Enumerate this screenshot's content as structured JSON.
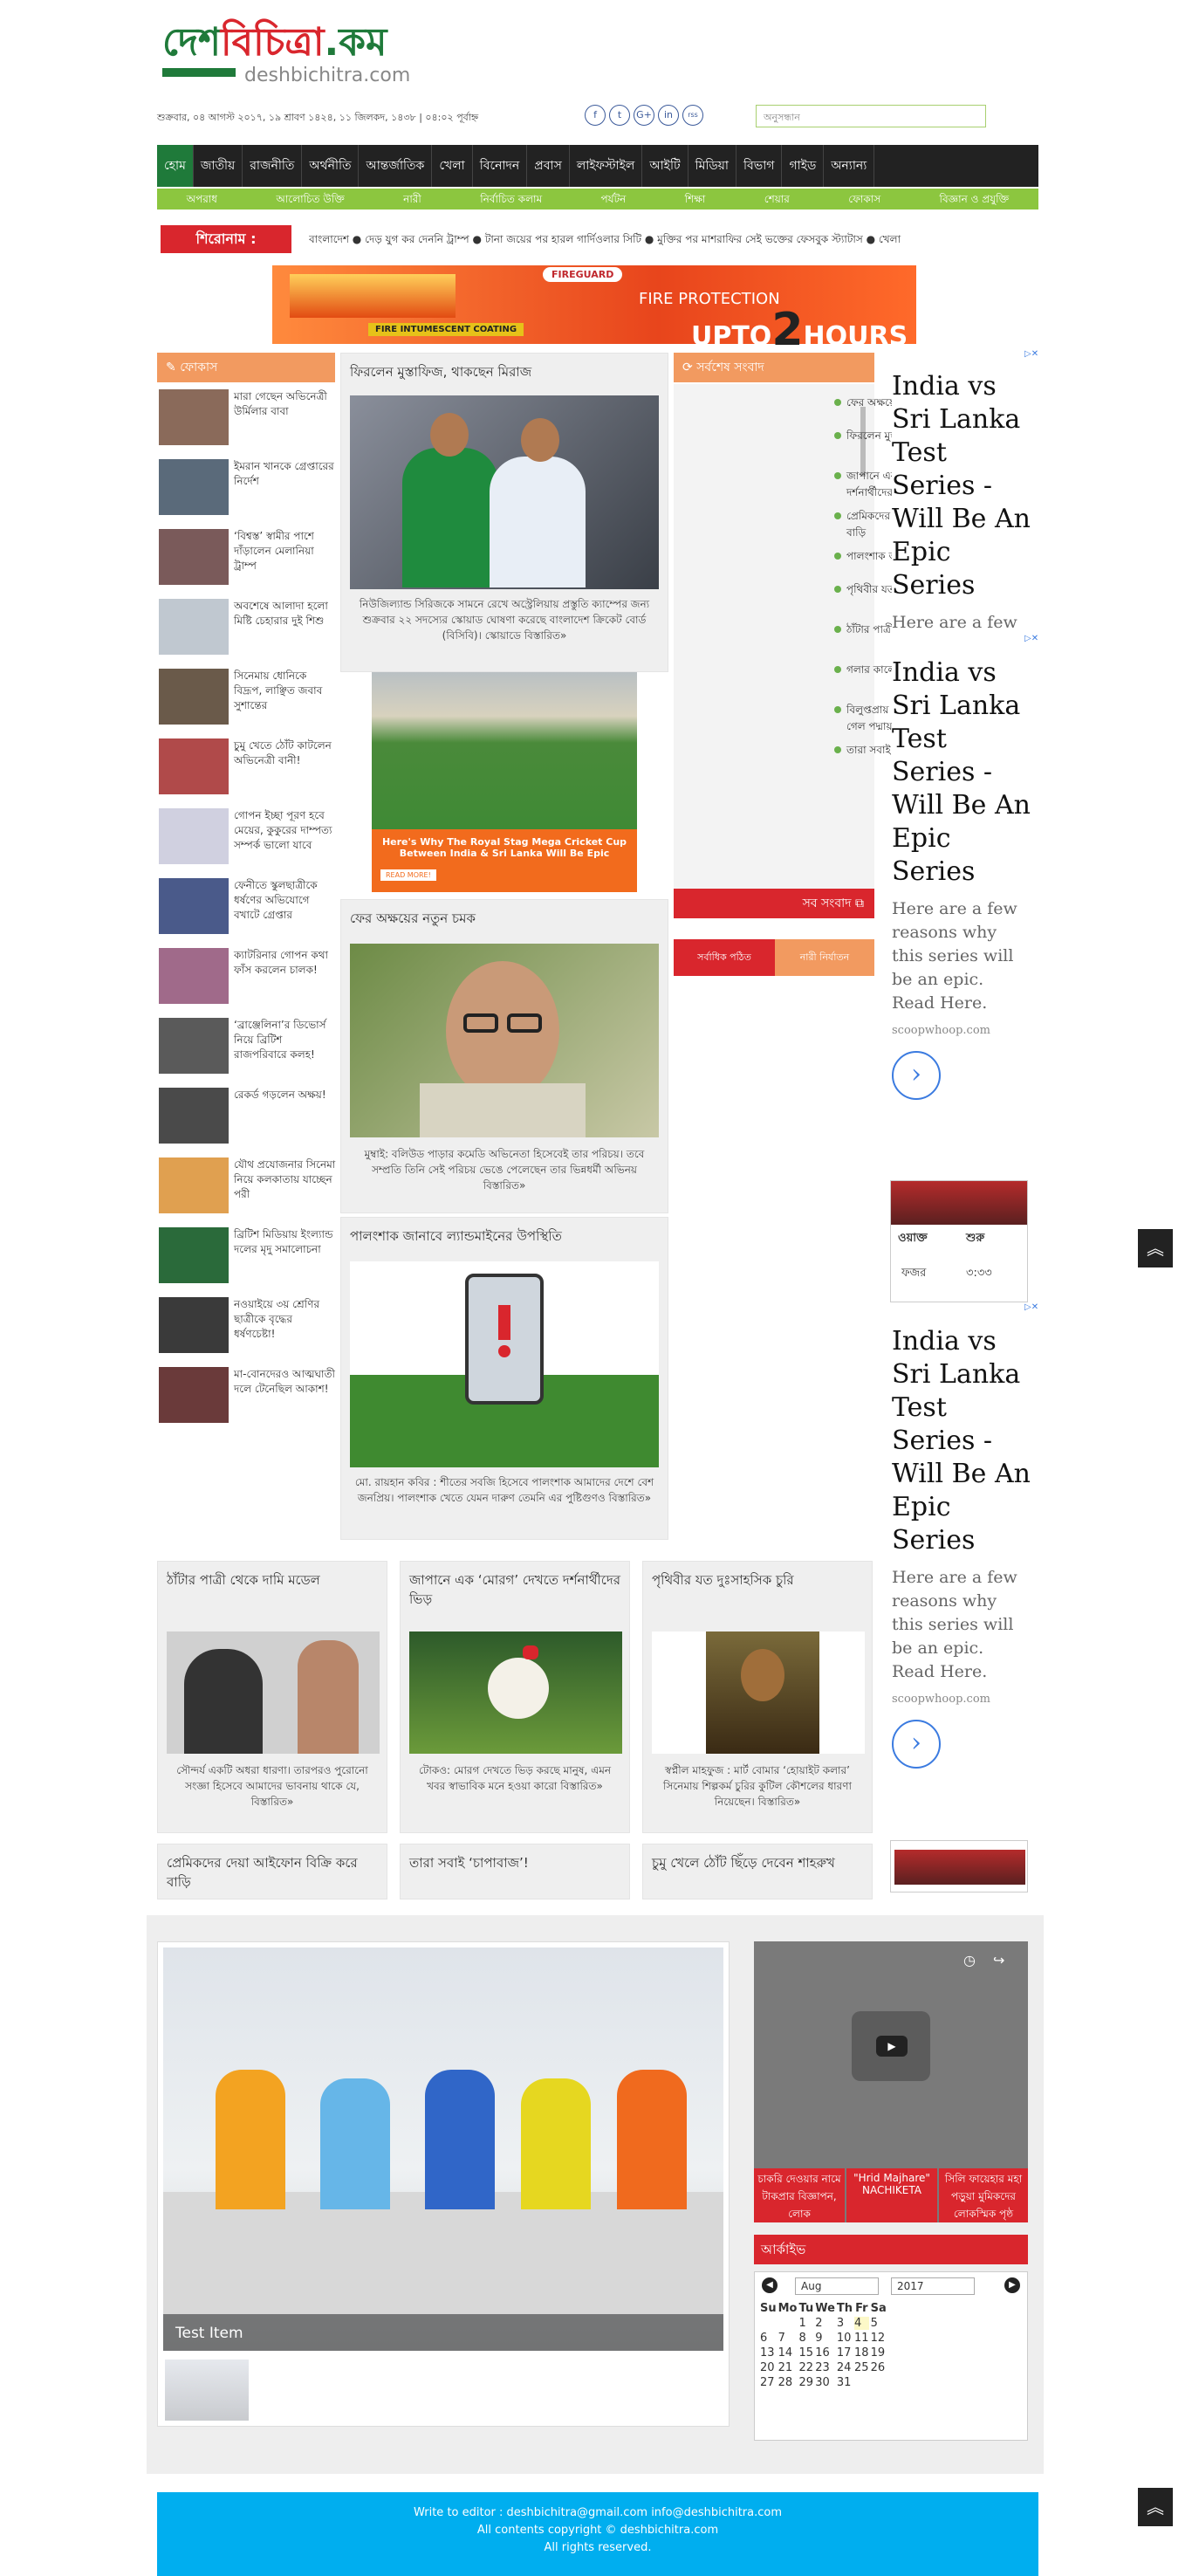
{
  "header": {
    "logo_text": "দেশবিচিত্রা.কম",
    "logo_part_green": "দেশ",
    "logo_part_red": "বিচিত্রা",
    "logo_part_green2": ".কম",
    "logo_subtext": "deshbichitra.com",
    "dateline": "শুক্রবার, ০৪ আগস্ট ২০১৭, ১৯ শ্রাবণ ১৪২৪, ১১ জিলকদ, ১৪৩৮ | ০৪:০২ পূর্বাহ্ন",
    "search_placeholder": "অনুসন্ধান",
    "social": [
      "f",
      "t",
      "G+",
      "in",
      "rss"
    ]
  },
  "nav": {
    "items": [
      "হোম",
      "জাতীয়",
      "রাজনীতি",
      "অর্থনীতি",
      "আন্তর্জাতিক",
      "খেলা",
      "বিনোদন",
      "প্রবাস",
      "লাইফস্টাইল",
      "আইটি",
      "মিডিয়া",
      "বিভাগ",
      "গাইড",
      "অন্যান্য"
    ],
    "sub": [
      "অপরাধ",
      "আলোচিত উক্তি",
      "নারী",
      "নির্বাচিত কলাম",
      "পর্যটন",
      "শিক্ষা",
      "শেয়ার",
      "ফোকাস",
      "বিজ্ঞান ও প্রযুক্তি"
    ]
  },
  "ticker": {
    "label": "শিরোনাম :",
    "text": "বাংলাদেশ ● দেড় যুগ কর দেননি ট্রাম্প ● টানা জয়ের পর হারল গার্দিওলার সিটি ● মুক্তির পর মাশরাফির সেই ভক্তের ফেসবুক স্ট্যাটাস ● খেলা"
  },
  "banner": {
    "brand": "FIREGUARD",
    "line1": "FIRE PROTECTION",
    "line2": "UPTO",
    "num": "2",
    "line3": "HOURS",
    "badge": "FIRE INTUMESCENT COATING"
  },
  "focus": {
    "title": "ফোকাস",
    "items": [
      "মারা গেছেন অভিনেত্রী উর্মিলার বাবা",
      "ইমরান খানকে গ্রেপ্তারের নির্দেশ",
      "‘বিশ্বস্ত’ স্বামীর পাশে দাঁড়ালেন মেলানিয়া ট্রাম্প",
      "অবশেষে আলাদা হলো মিষ্টি চেহারার দুই শিশু",
      "সিনেমায় ধোনিকে বিদ্রূপ, লাঞ্ছিত জবাব সুশান্তের",
      "চুমু খেতে ঠোঁট কাটলেন অভিনেত্রী বানী!",
      "গোপন ইচ্ছা পূরণ হবে মেয়ের, কুকুরের দাম্পত্য সম্পর্ক ভালো যাবে",
      "ফেনীতে স্কুলছাত্রীকে ধর্ষণের অভিযোগে বখাটে গ্রেপ্তার",
      "ক্যাটরিনার গোপন কথা ফাঁস করলেন চালক!",
      "‘ব্রাঞ্জেলিনা’র ডিভোর্স নিয়ে ব্রিটিশ রাজপরিবারে কলহ!",
      "রেকর্ড গড়লেন অক্ষয়!",
      "যৌথ প্রযোজনার সিনেমা নিয়ে কলকাতায় যাচ্ছেন পরী",
      "ব্রিটিশ মিডিয়ায় ইংল্যান্ড দলের মৃদু সমালোচনা",
      "নওয়াইয়ে ৩য় শ্রেণির ছাত্রীকে বৃদ্ধের ধর্ষণচেষ্টা!",
      "মা-বোনদেরও আত্মঘাতী দলে টেনেছিল আকাশ!"
    ]
  },
  "mid": {
    "story1": {
      "title": "ফিরলেন মুস্তাফিজ, থাকছেন মিরাজ",
      "text": "নিউজিল্যান্ড সিরিজকে সামনে রেখে অস্ট্রেলিয়ায় প্রস্তুতি ক্যাম্পের জন্য শুক্রবার ২২ সদস্যের স্কোয়াড ঘোষণা করেছে বাংলাদেশ ক্রিকেট বোর্ড (বিসিবি)। স্কোয়াডে বিস্তারিত»"
    },
    "ad": {
      "text": "Here's Why The Royal Stag Mega Cricket Cup Between India & Sri Lanka Will Be Epic",
      "cta": "READ MORE!"
    },
    "story2": {
      "title": "ফের অক্ষয়ের নতুন চমক",
      "text": "মুম্বাই: বলিউড পাড়ার কমেডি অভিনেতা হিসেবেই তার পরিচয়। তবে সম্প্রতি তিনি সেই পরিচয় ভেঙে পেলেছেন তার ভিন্নধর্মী অভিনয় বিস্তারিত»"
    },
    "story3": {
      "title": "পালংশাক জানাবে ল্যান্ডমাইনের উপস্থিতি",
      "text": "মো. রায়হান কবির : শীতের সবজি হিসেবে পালংশাক আমাদের দেশে বেশ জনপ্রিয়। পালংশাক খেতে যেমন দারুণ তেমনি এর পুষ্টিগুণও বিস্তারিত»"
    }
  },
  "latest": {
    "title": "সর্বশেষ সংবাদ",
    "items": [
      "ফের অক্ষয়ের নতুন চমক",
      "ফিরলেন মুস্তাফিজ, থাকছেন মিরাজ",
      "জাপানে এক ‘মোরগ’ দেখতে দর্শনার্থীদের ভিড়",
      "প্রেমিকদের দেয়া আইফোন বিক্রি করে বাড়ি",
      "পালংশাক জানাবে",
      "পৃথিবীর যত দুঃসাহসিক চুরি",
      "ঠাঁটার পাত্রী থেকে দামি মডেল",
      "গলার কালো দাগ দূর করতে চান?",
      "বিলুপ্তপ্রায় ঘড়িয়ালের দেখা পাওয়া গেল পদ্মায়",
      "তারা সবাই ‘চাপাবাজ’!"
    ],
    "all": "সব সংবাদ",
    "tab1": "সর্বাধিক পঠিত",
    "tab2": "নারী নির্যাতন"
  },
  "ads": {
    "title": "India vs Sri Lanka Test Series - Will Be An Epic Series",
    "desc": "Here are a few reasons why this series will be an epic. Read Here.",
    "source": "scoopwhoop.com",
    "prayer": {
      "h1": "ওয়াক্ত",
      "h2": "শুরু",
      "row": "ফজর",
      "time": "৩:৩৩"
    }
  },
  "row": [
    {
      "title": "ঠাঁটার পাত্রী থেকে দামি মডেল",
      "text": "সৌন্দর্য একটি অধরা ধারণা। তারপরও পুরোনো সংজ্ঞা হিসেবে আমাদের ভাবনায় থাকে যে, বিস্তারিত»"
    },
    {
      "title": "জাপানে এক ‘মোরগ’ দেখতে দর্শনার্থীদের ভিড়",
      "text": "টোকও: মোরগ দেখতে ভিড় করছে মানুষ, এমন খবর স্বাভাবিক মনে হওয়া কারো বিস্তারিত»"
    },
    {
      "title": "পৃথিবীর যত দুঃসাহসিক চুরি",
      "text": "স্বপ্নীল মাহফুজ : মার্ট বোমার ‘হোয়াইট কলার’ সিনেমায় শিল্পকর্ম চুরির কুটিল কৌশলের ধারণা নিয়েছেন। বিস্তারিত»"
    }
  ],
  "row2": [
    "প্রেমিকদের দেয়া আইফোন বিক্রি করে বাড়ি",
    "তারা সবাই ‘চাপাবাজ’!",
    "চুমু খেলে ঠোঁট ছিঁড়ে দেবেন শাহরুখ"
  ],
  "gallery": {
    "caption": "Test Item"
  },
  "video": {
    "captions": [
      "চাকরি দেওয়ার নামে টাকপ্রার বিজ্ঞাপন, লোক",
      "\"Hrid Majhare\" NACHIKETA",
      "সিলি ফায়েহার মহা পড়ুয়া মুমিকদের লোকস্মিক পৃষ্ঠ"
    ]
  },
  "archive": {
    "title": "আর্কাইভ",
    "month": "Aug",
    "year": "2017",
    "days": [
      "Su",
      "Mo",
      "Tu",
      "We",
      "Th",
      "Fr",
      "Sa"
    ],
    "weeks": [
      [
        "",
        "",
        "1",
        "2",
        "3",
        "4",
        "5"
      ],
      [
        "6",
        "7",
        "8",
        "9",
        "10",
        "11",
        "12"
      ],
      [
        "13",
        "14",
        "15",
        "16",
        "17",
        "18",
        "19"
      ],
      [
        "20",
        "21",
        "22",
        "23",
        "24",
        "25",
        "26"
      ],
      [
        "27",
        "28",
        "29",
        "30",
        "31",
        "",
        ""
      ]
    ]
  },
  "footer": {
    "line1": "Write to editor : deshbichitra@gmail.com    info@deshbichitra.com",
    "line2": "All contents copyright © deshbichitra.com",
    "line3": "All rights reserved."
  }
}
